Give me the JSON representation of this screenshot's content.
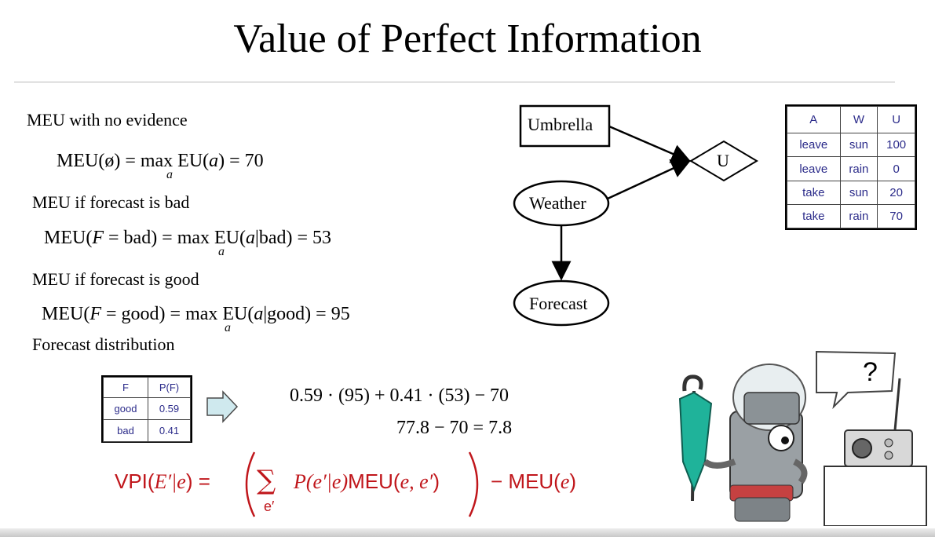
{
  "title": "Value of Perfect Information",
  "left": {
    "meu_none_label": "MEU with no evidence",
    "meu_none_lhs": "MEU(ø) = max EU(",
    "meu_none_var": "a",
    "meu_none_rhs": ") = 70",
    "sub_a": "a",
    "meu_bad_label": "MEU if forecast is bad",
    "meu_bad_lhs": "MEU(",
    "meu_bad_mid": " = bad) = max EU(",
    "meu_bad_rhs": "|bad) = 53",
    "meu_good_label": "MEU if forecast is good",
    "meu_good_lhs": "MEU(",
    "meu_good_mid": " = good) = max EU(",
    "meu_good_rhs": "|good) = 95",
    "forecast_dist_label": "Forecast distribution",
    "var_F": "F"
  },
  "forecast_table": {
    "headers": [
      "F",
      "P(F)"
    ],
    "rows": [
      [
        "good",
        "0.59"
      ],
      [
        "bad",
        "0.41"
      ]
    ]
  },
  "calc": {
    "line1": "0.59 · (95) + 0.41 · (53) − 70",
    "line2": "77.8 − 70 = 7.8"
  },
  "network": {
    "nodes": {
      "umbrella": "Umbrella",
      "utility": "U",
      "weather": "Weather",
      "forecast": "Forecast"
    }
  },
  "utility_table": {
    "headers": [
      "A",
      "W",
      "U"
    ],
    "rows": [
      [
        "leave",
        "sun",
        "100"
      ],
      [
        "leave",
        "rain",
        "0"
      ],
      [
        "take",
        "sun",
        "20"
      ],
      [
        "take",
        "rain",
        "70"
      ]
    ]
  },
  "vpi": {
    "lhs_text": "VPI(",
    "lhs_args": "E′|e",
    "lhs_close": ") =",
    "sum_sub": "e′",
    "term": "P(e′|e)",
    "meu1": "MEU(",
    "meu1_args": "e, e′",
    "meu1_close": ")",
    "minus": "− MEU(",
    "meu2_args": "e",
    "meu2_close": ")"
  },
  "thought_bubble": "?",
  "colors": {
    "vpi_red": "#c0161b",
    "table_text": "#2b2b8a",
    "arrow_fill": "#cfe9ee",
    "umbrella_teal": "#1fb39a"
  }
}
